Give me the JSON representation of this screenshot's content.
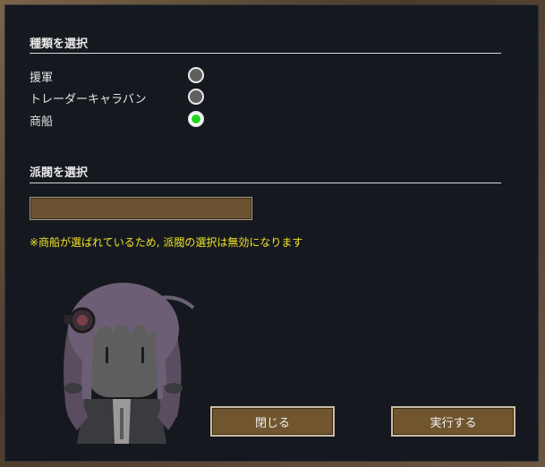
{
  "kind_section": {
    "title": "種類を選択",
    "options": [
      {
        "label": "援軍",
        "selected": false
      },
      {
        "label": "トレーダーキャラバン",
        "selected": false
      },
      {
        "label": "商船",
        "selected": true
      }
    ]
  },
  "faction_section": {
    "title": "派閥を選択",
    "selected_value": "",
    "notice": "※商船が選ばれているため, 派閥の選択は無効になります"
  },
  "buttons": {
    "close_label": "閉じる",
    "execute_label": "実行する"
  },
  "colors": {
    "dialog_bg": "#15191f",
    "button_bg": "#70552e",
    "notice_text": "#f2e12a",
    "radio_selected": "#22d61e"
  },
  "icons": {
    "mascot": "chibi-character-illustration"
  }
}
